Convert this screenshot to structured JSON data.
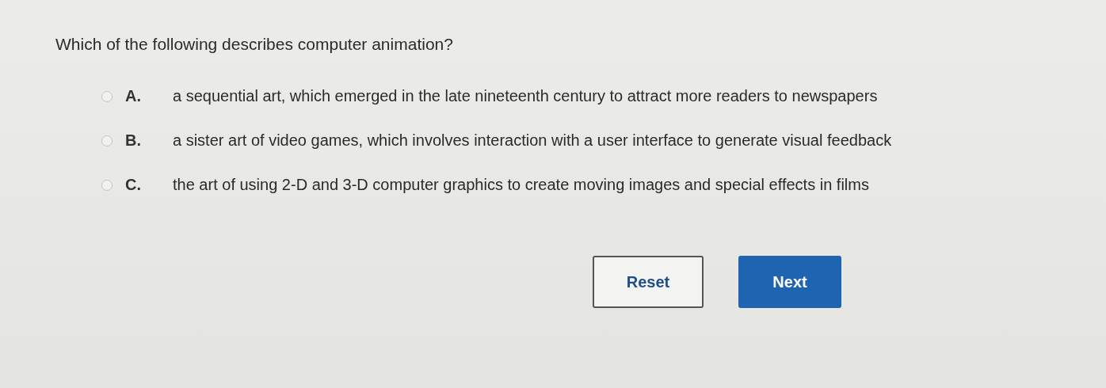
{
  "question": "Which of the following describes computer animation?",
  "options": [
    {
      "letter": "A.",
      "text": "a sequential art, which emerged in the late nineteenth century to attract more readers to newspapers",
      "selected": false
    },
    {
      "letter": "B.",
      "text": "a sister art of video games, which involves interaction with a user interface to generate visual feedback",
      "selected": false
    },
    {
      "letter": "C.",
      "text": "the art of using 2-D and 3-D computer graphics to create moving images and special effects in films",
      "selected": false
    }
  ],
  "buttons": [
    {
      "label": "Reset",
      "kind": "secondary"
    },
    {
      "label": "Next",
      "kind": "primary"
    }
  ]
}
